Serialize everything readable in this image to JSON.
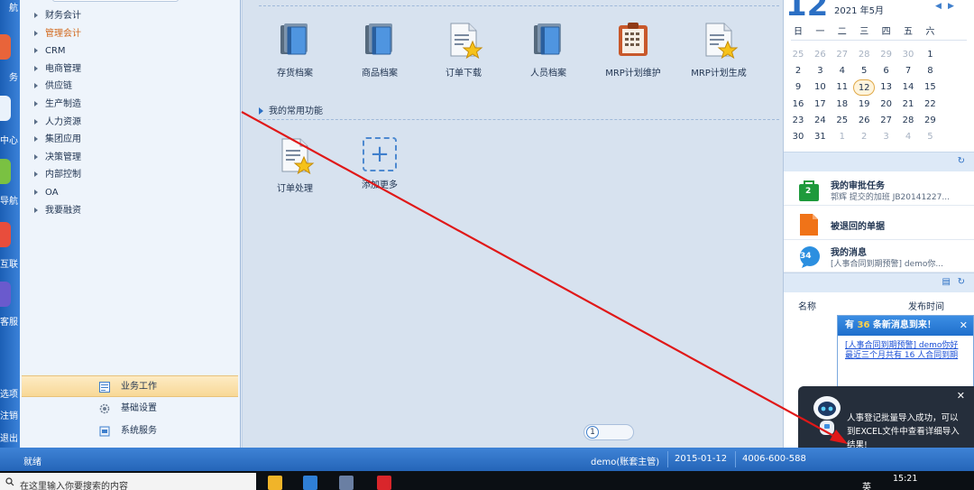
{
  "leftbar": {
    "items": [
      "航",
      "务",
      "中心",
      "导航",
      "互联",
      "客服"
    ],
    "bottom": [
      "选项",
      "注销",
      "退出"
    ]
  },
  "tree": {
    "items": [
      {
        "label": "财务会计",
        "active": false
      },
      {
        "label": "管理会计",
        "active": true
      },
      {
        "label": "CRM",
        "active": false
      },
      {
        "label": "电商管理",
        "active": false
      },
      {
        "label": "供应链",
        "active": false
      },
      {
        "label": "生产制造",
        "active": false
      },
      {
        "label": "人力资源",
        "active": false
      },
      {
        "label": "集团应用",
        "active": false
      },
      {
        "label": "决策管理",
        "active": false
      },
      {
        "label": "内部控制",
        "active": false
      },
      {
        "label": "OA",
        "active": false
      },
      {
        "label": "我要融资",
        "active": false
      }
    ],
    "bottom_buttons": [
      {
        "label": "业务工作",
        "icon": "workbench-icon",
        "active": true
      },
      {
        "label": "基础设置",
        "icon": "gear-icon",
        "active": false
      },
      {
        "label": "系统服务",
        "icon": "system-service-icon",
        "active": false
      }
    ]
  },
  "main": {
    "apps": [
      {
        "label": "存货档案",
        "icon": "ledger-books-icon"
      },
      {
        "label": "商品档案",
        "icon": "ledger-books-icon"
      },
      {
        "label": "订单下载",
        "icon": "document-star-icon"
      },
      {
        "label": "人员档案",
        "icon": "ledger-books-icon"
      },
      {
        "label": "MRP计划维护",
        "icon": "clipboard-icon"
      },
      {
        "label": "MRP计划生成",
        "icon": "document-star-icon"
      }
    ],
    "common_title": "我的常用功能",
    "common": [
      {
        "label": "订单处理",
        "icon": "document-star-icon"
      },
      {
        "label": "添加更多",
        "icon": "add-icon"
      }
    ],
    "page_number": "1"
  },
  "calendar": {
    "big_day": "12",
    "year_month": "2021 年5月",
    "weekdays": [
      "日",
      "一",
      "二",
      "三",
      "四",
      "五",
      "六"
    ],
    "weeks": [
      [
        "25",
        "26",
        "27",
        "28",
        "29",
        "30",
        "1"
      ],
      [
        "2",
        "3",
        "4",
        "5",
        "6",
        "7",
        "8"
      ],
      [
        "9",
        "10",
        "11",
        "12",
        "13",
        "14",
        "15"
      ],
      [
        "16",
        "17",
        "18",
        "19",
        "20",
        "21",
        "22"
      ],
      [
        "23",
        "24",
        "25",
        "26",
        "27",
        "28",
        "29"
      ],
      [
        "30",
        "31",
        "1",
        "2",
        "3",
        "4",
        "5"
      ]
    ],
    "today": "12"
  },
  "tasks": [
    {
      "title": "我的审批任务",
      "sub": "郭辉 提交的加班 JB20141227...",
      "badge": "2",
      "color": "#1e9a3c"
    },
    {
      "title": "被退回的单据",
      "sub": "",
      "badge": "",
      "color": "#f07318"
    },
    {
      "title": "我的消息",
      "sub": "[人事合同到期预警] demo你...",
      "badge": "34",
      "color": "#2b8fe0"
    }
  ],
  "list_header": {
    "name": "名称",
    "time": "发布时间"
  },
  "popup_new_msg": {
    "prefix": "有",
    "count": "36",
    "suffix": "条新消息到来！",
    "link": "[人事合同到期预警] demo你好最近三个月共有 16 人合同到期"
  },
  "popup_import": {
    "message": "人事登记批量导入成功，可以到EXCEL文件中查看详细导入结果!"
  },
  "status": {
    "ready": "就绪",
    "user": "demo(账套主管)",
    "date": "2015-01-12",
    "phone": "4006-600-588"
  },
  "taskbar": {
    "search": "在这里输入你要搜索的内容",
    "ime": "英",
    "time": "15:21"
  },
  "colors": {
    "accent": "#2b6fc4",
    "annotation": "#e01818",
    "status_bar": "#2565b8"
  }
}
